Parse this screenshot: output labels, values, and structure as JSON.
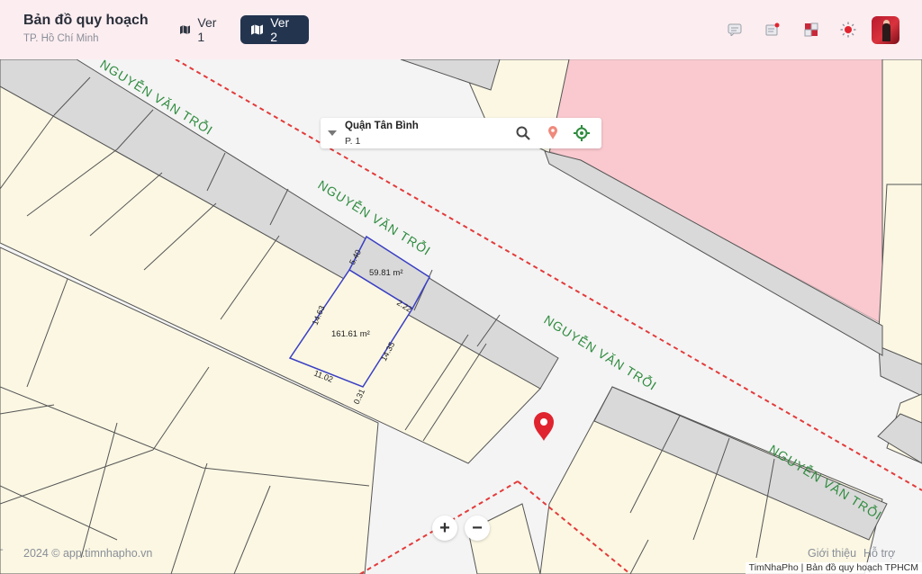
{
  "header": {
    "title": "Bản đồ quy hoạch",
    "subtitle": "TP. Hồ Chí Minh",
    "versions": [
      {
        "label": "Ver 1",
        "active": false
      },
      {
        "label": "Ver 2",
        "active": true
      }
    ],
    "icons": [
      "chat-icon",
      "notes-icon",
      "layers-icon",
      "theme-sun-icon"
    ],
    "active_color": "#23344f"
  },
  "search": {
    "district": "Quận Tân Bình",
    "ward": "P. 1"
  },
  "map": {
    "street_labels": [
      "NGUYỄN VĂN TRỖI",
      "NGUYỄN VĂN TRỖI",
      "NGUYỄN VĂN TRỖI",
      "NGUYỄN VĂN TRỖI"
    ],
    "parcels": {
      "upper_area": "59.81 m²",
      "lower_area": "161.61 m²",
      "dimensions": [
        "5.40",
        "14.63",
        "2.22",
        "14.35",
        "11.02",
        "0.31"
      ]
    },
    "colors": {
      "parcel_fill": "#fbf7e3",
      "road_fill": "#f5f5f5",
      "setback_strip": "#d9d9d9",
      "pink_zone": "#f9c9cf",
      "boundary_dash": "#e33b3b",
      "selected_outline": "#3a3fc4",
      "street_label": "#2e8b3e",
      "marker": "#e0242f"
    }
  },
  "zoom": {
    "in": "+",
    "out": "−"
  },
  "footer": {
    "copyright": "2024 ©  app.timnhapho.vn",
    "links": [
      "Giới thiệu",
      "Hỗ trợ"
    ],
    "attribution": "TimNhaPho | Bản đồ quy hoạch TPHCM",
    "edge_mark": "-"
  }
}
